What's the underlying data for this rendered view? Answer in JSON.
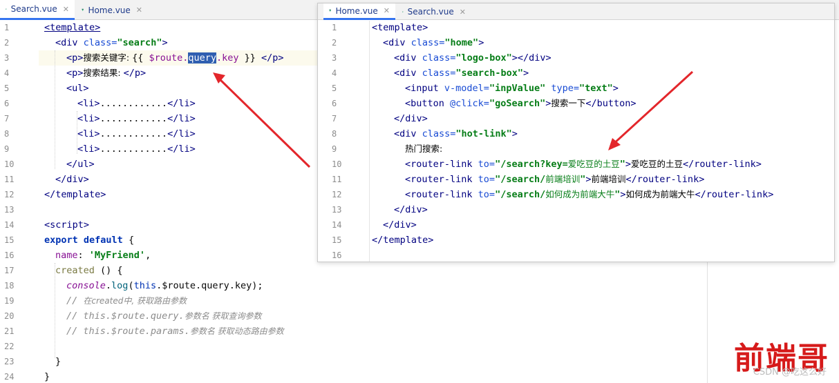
{
  "main_editor": {
    "tabs": [
      {
        "label": "Search.vue",
        "active": true
      },
      {
        "label": "Home.vue",
        "active": false
      }
    ],
    "line_numbers": [
      "1",
      "2",
      "3",
      "4",
      "5",
      "6",
      "7",
      "8",
      "9",
      "10",
      "11",
      "12",
      "13",
      "14",
      "15",
      "16",
      "17",
      "18",
      "19",
      "20",
      "21",
      "22",
      "23",
      "24"
    ],
    "lines": {
      "l1": "<template>",
      "l2_a": "<div ",
      "l2_b": "class=",
      "l2_c": "\"search\"",
      "l2_d": ">",
      "l3_a": "<p>",
      "l3_b": "搜索关键字: ",
      "l3_c": "{{ ",
      "l3_d": "$route.",
      "l3_e": "query",
      "l3_f": ".key",
      "l3_g": " }} ",
      "l3_h": "</p>",
      "l4_a": "<p>",
      "l4_b": "搜索结果: ",
      "l4_c": "</p>",
      "l5": "<ul>",
      "li_open": "<li>",
      "li_dots": "............",
      "li_close": "</li>",
      "l10": "</ul>",
      "l11": "</div>",
      "l12": "</template>",
      "l14": "<script>",
      "l15_a": "export ",
      "l15_b": "default ",
      "l15_c": "{",
      "l16_a": "name",
      "l16_b": ": ",
      "l16_c": "'MyFriend'",
      "l16_d": ",",
      "l17_a": "created",
      "l17_b": " () {",
      "l18_a": "console",
      "l18_b": ".",
      "l18_c": "log",
      "l18_d": "(",
      "l18_e": "this",
      "l18_f": ".$route.query.key);",
      "l19_a": "// ",
      "l19_b": "在created中, 获取路由参数",
      "l20_a": "// this.$route.query.",
      "l20_b": "参数名 获取查询参数",
      "l21_a": "// this.$route.params.",
      "l21_b": "参数名 获取动态路由参数",
      "l23": "}",
      "l24": "}"
    }
  },
  "popup_editor": {
    "tabs": [
      {
        "label": "Home.vue",
        "active": true
      },
      {
        "label": "Search.vue",
        "active": false
      }
    ],
    "line_numbers": [
      "1",
      "2",
      "3",
      "4",
      "5",
      "6",
      "7",
      "8",
      "9",
      "10",
      "11",
      "12",
      "13",
      "14",
      "15",
      "16"
    ],
    "lines": {
      "p1": "<template>",
      "p2_a": "<div ",
      "p2_b": "class=",
      "p2_c": "\"home\"",
      "p2_d": ">",
      "p3_a": "<div ",
      "p3_b": "class=",
      "p3_c": "\"logo-box\"",
      "p3_d": "></div>",
      "p4_a": "<div ",
      "p4_b": "class=",
      "p4_c": "\"search-box\"",
      "p4_d": ">",
      "p5_a": "<input ",
      "p5_b": "v-model=",
      "p5_c": "\"inpValue\"",
      "p5_d": " type=",
      "p5_e": "\"text\"",
      "p5_f": ">",
      "p6_a": "<button ",
      "p6_b": "@click=",
      "p6_c": "\"goSearch\"",
      "p6_d": ">",
      "p6_e": "搜索一下",
      "p6_f": "</button>",
      "p7": "</div>",
      "p8_a": "<div ",
      "p8_b": "class=",
      "p8_c": "\"hot-link\"",
      "p8_d": ">",
      "p9": "热门搜索:",
      "p10_a": "<router-link ",
      "p10_b": "to=",
      "p10_c": "\"/search?key=",
      "p10_d": "爱吃豆的土豆",
      "p10_e": "\"",
      "p10_f": ">",
      "p10_g": "爱吃豆的土豆",
      "p10_h": "</router-link>",
      "p11_a": "<router-link ",
      "p11_b": "to=",
      "p11_c": "\"/search/",
      "p11_d": "前端培训",
      "p11_e": "\"",
      "p11_f": ">",
      "p11_g": "前端培训",
      "p11_h": "</router-link>",
      "p12_a": "<router-link ",
      "p12_b": "to=",
      "p12_c": "\"/search/",
      "p12_d": "如何成为前端大牛",
      "p12_e": "\"",
      "p12_f": ">",
      "p12_g": "如何成为前端大牛",
      "p12_h": "</router-link>",
      "p13": "</div>",
      "p14": "</div>",
      "p15": "</template>"
    }
  },
  "watermark": {
    "brand": "前端哥",
    "credit": "CSDN @吃这么好"
  },
  "colors": {
    "arrow": "#e3262b",
    "tab_active_underline": "#3574f0",
    "selection": "#2f5fb0",
    "current_line": "#fcfaed"
  }
}
